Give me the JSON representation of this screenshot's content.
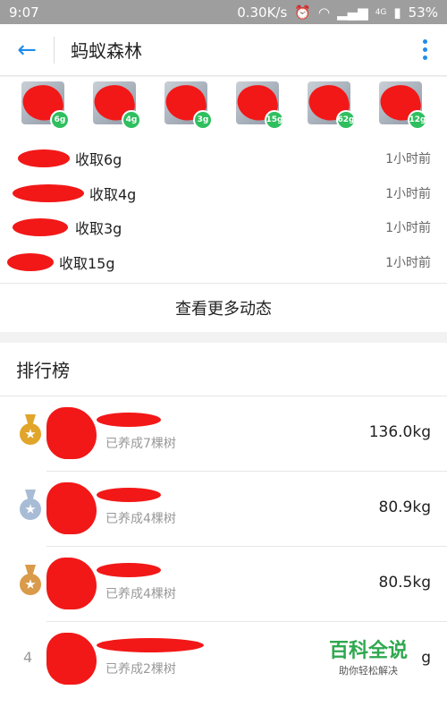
{
  "status_bar": {
    "time": "9:07",
    "speed": "0.30K/s",
    "network": "4G",
    "battery": "53%"
  },
  "header": {
    "title": "蚂蚁森林",
    "back_icon": "arrow-left-icon",
    "more_icon": "more-vertical-icon"
  },
  "avatars": [
    {
      "badge": "6g"
    },
    {
      "badge": "4g"
    },
    {
      "badge": "3g"
    },
    {
      "badge": "15g"
    },
    {
      "badge": "62g"
    },
    {
      "badge": "12g"
    }
  ],
  "feed": [
    {
      "action": "收取6g",
      "time": "1小时前"
    },
    {
      "action": "收取4g",
      "time": "1小时前"
    },
    {
      "action": "收取3g",
      "time": "1小时前"
    },
    {
      "action": "收取15g",
      "time": "1小时前"
    }
  ],
  "more_link": "查看更多动态",
  "ranking": {
    "title": "排行榜",
    "rows": [
      {
        "rank_icon": "gold-medal-icon",
        "sub": "已养成7棵树",
        "value": "136.0kg"
      },
      {
        "rank_icon": "silver-medal-icon",
        "sub": "已养成4棵树",
        "value": "80.9kg"
      },
      {
        "rank_icon": "bronze-medal-icon",
        "sub": "已养成4棵树",
        "value": "80.5kg"
      },
      {
        "rank": "4",
        "sub": "已养成2棵树",
        "value": "g"
      }
    ]
  },
  "watermark": {
    "title": "百科全说",
    "subtitle": "助你轻松解决"
  },
  "colors": {
    "accent": "#1f8ceb",
    "badge": "#2fbf5f",
    "redaction": "#f21818",
    "gold": "#e0a52a",
    "silver": "#a8bcd6",
    "bronze": "#d99a4a"
  }
}
